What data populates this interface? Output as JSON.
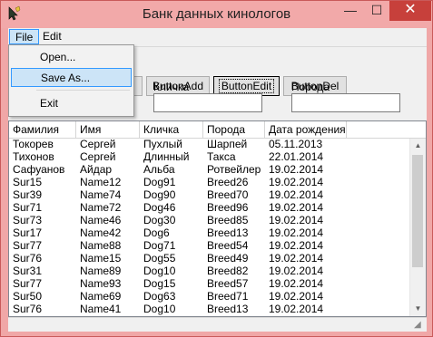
{
  "window": {
    "title": "Банк данных кинологов",
    "minimize_glyph": "—",
    "maximize_glyph": "☐",
    "close_glyph": "✕",
    "icon": "cursor-app-icon"
  },
  "menu": {
    "file": "File",
    "edit": "Edit"
  },
  "file_menu": {
    "items": [
      "Open...",
      "Save As...",
      "Exit"
    ],
    "highlighted": "Save As..."
  },
  "toolbar": {
    "partial_button": "as",
    "add": "ButtonAdd",
    "edit": "ButtonEdit",
    "del": "ButtonDel"
  },
  "filters": {
    "nickname_label": "Кличка",
    "breed_label": "Порода",
    "nickname_value": "",
    "breed_value": ""
  },
  "table": {
    "columns": [
      "Фамилия",
      "Имя",
      "Кличка",
      "Порода",
      "Дата рождения"
    ],
    "rows": [
      [
        "Токорев",
        "Сергей",
        "Пухлый",
        "Шарпей",
        "05.11.2013"
      ],
      [
        "Тихонов",
        "Сергей",
        "Длинный",
        "Такса",
        "22.01.2014"
      ],
      [
        "Сафуанов",
        "Айдар",
        "Альба",
        "Ротвейлер",
        "19.02.2014"
      ],
      [
        "Sur15",
        "Name12",
        "Dog91",
        "Breed26",
        "19.02.2014"
      ],
      [
        "Sur39",
        "Name74",
        "Dog90",
        "Breed70",
        "19.02.2014"
      ],
      [
        "Sur71",
        "Name72",
        "Dog46",
        "Breed96",
        "19.02.2014"
      ],
      [
        "Sur73",
        "Name46",
        "Dog30",
        "Breed85",
        "19.02.2014"
      ],
      [
        "Sur17",
        "Name42",
        "Dog6",
        "Breed13",
        "19.02.2014"
      ],
      [
        "Sur77",
        "Name88",
        "Dog71",
        "Breed54",
        "19.02.2014"
      ],
      [
        "Sur76",
        "Name15",
        "Dog55",
        "Breed49",
        "19.02.2014"
      ],
      [
        "Sur31",
        "Name89",
        "Dog10",
        "Breed82",
        "19.02.2014"
      ],
      [
        "Sur77",
        "Name93",
        "Dog15",
        "Breed57",
        "19.02.2014"
      ],
      [
        "Sur50",
        "Name69",
        "Dog63",
        "Breed71",
        "19.02.2014"
      ],
      [
        "Sur76",
        "Name41",
        "Dog10",
        "Breed13",
        "19.02.2014"
      ]
    ]
  },
  "scrollbar": {
    "up_glyph": "▲",
    "down_glyph": "▼"
  },
  "status": {
    "grip_glyph": "◢"
  }
}
